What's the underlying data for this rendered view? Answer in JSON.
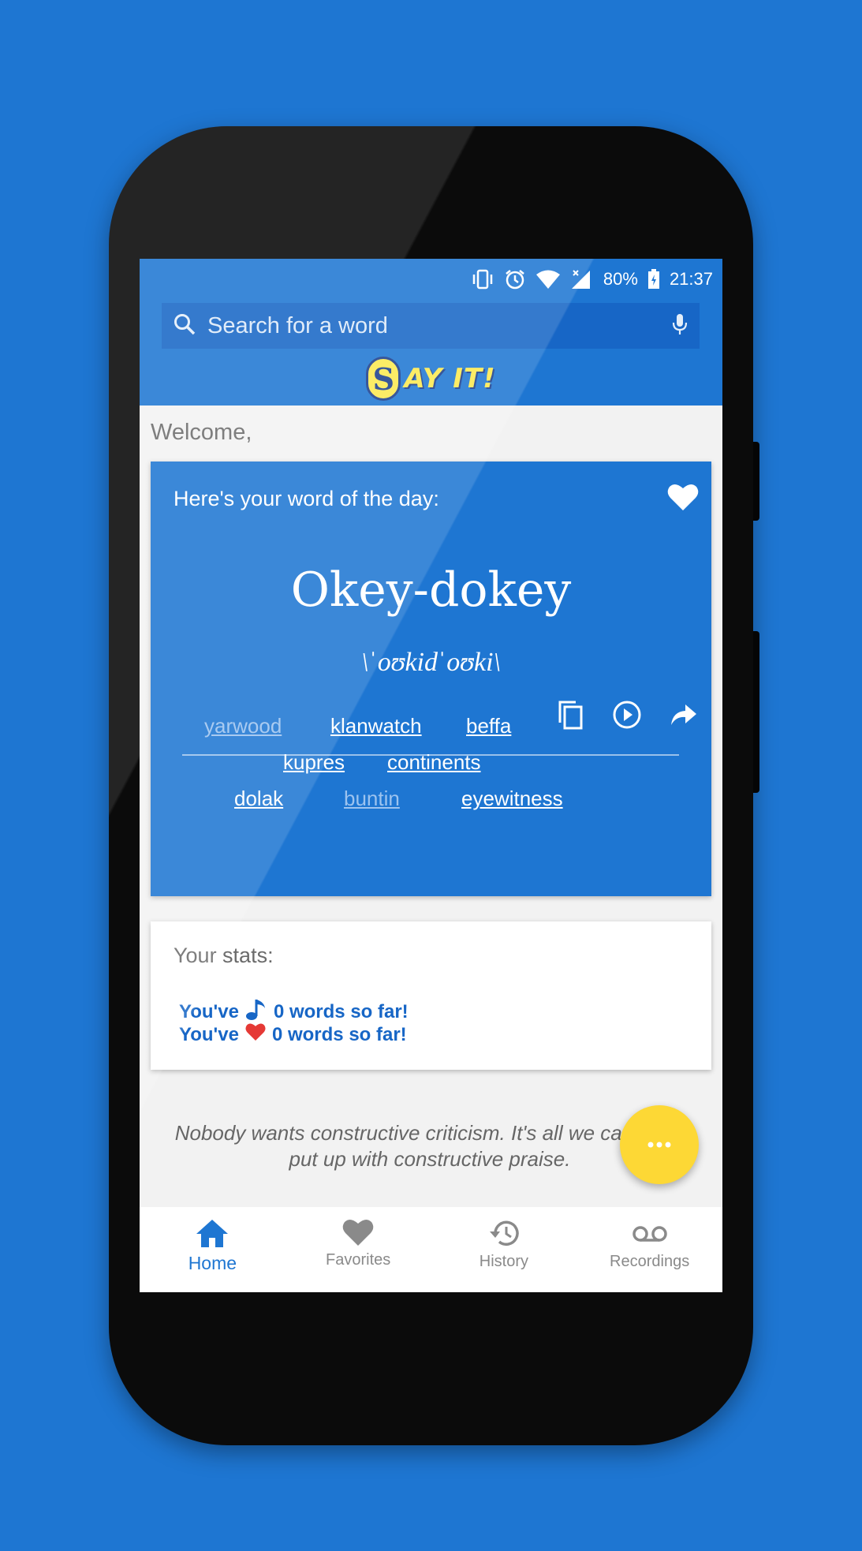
{
  "status_bar": {
    "battery": "80%",
    "time": "21:37"
  },
  "search": {
    "placeholder": "Search for a word"
  },
  "logo": {
    "initial": "S",
    "text": "AY IT!"
  },
  "welcome": "Welcome,",
  "word_of_day": {
    "header": "Here's your word of the day:",
    "word": "Okey-dokey",
    "phonetic": "\\ˈoʊkidˈoʊki\\",
    "related_words": [
      {
        "text": "yarwood",
        "visited": true
      },
      {
        "text": "klanwatch",
        "visited": false
      },
      {
        "text": "beffa",
        "visited": false
      },
      {
        "text": "kupres",
        "visited": false
      },
      {
        "text": "continents",
        "visited": false
      },
      {
        "text": "dolak",
        "visited": false
      },
      {
        "text": "buntin",
        "visited": true
      },
      {
        "text": "eyewitness",
        "visited": false
      }
    ]
  },
  "stats": {
    "title": "Your stats:",
    "line1_prefix": "You've",
    "line1_suffix": "0 words so far!",
    "line2_prefix": "You've",
    "line2_suffix": "0 words so far!"
  },
  "quote": "Nobody wants constructive criticism.  It's all we can do to put up with constructive praise.",
  "fab": {
    "label": "···"
  },
  "bottom_nav": [
    {
      "label": "Home",
      "icon": "home-icon",
      "active": true
    },
    {
      "label": "Favorites",
      "icon": "heart-icon",
      "active": false
    },
    {
      "label": "History",
      "icon": "history-icon",
      "active": false
    },
    {
      "label": "Recordings",
      "icon": "voicemail-icon",
      "active": false
    }
  ],
  "colors": {
    "primary": "#1e76d2",
    "accent": "#fdd835",
    "logo": "#fce94f"
  }
}
